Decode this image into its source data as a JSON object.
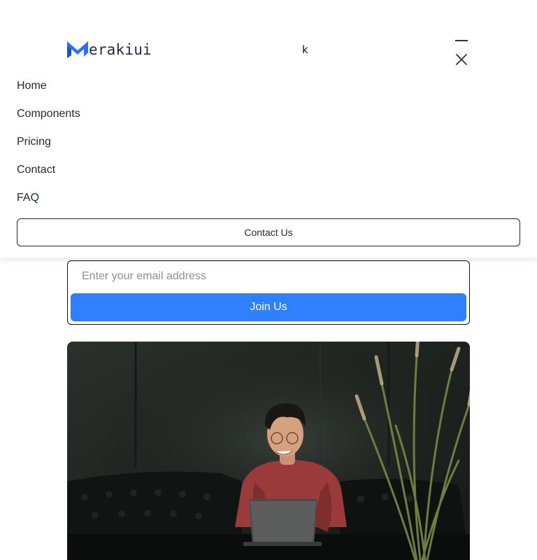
{
  "brand": {
    "logo_text": "erakiui",
    "logo_icon": "m-logo-icon",
    "accent": "#2f80ff"
  },
  "header": {
    "stray_text": "k",
    "menu_icon": "hamburger-icon",
    "close_icon": "close-icon"
  },
  "nav": {
    "items": [
      {
        "label": "Home"
      },
      {
        "label": "Components"
      },
      {
        "label": "Pricing"
      },
      {
        "label": "Contact"
      },
      {
        "label": "FAQ"
      }
    ],
    "contact_button": "Contact Us"
  },
  "signup": {
    "email_placeholder": "Enter your email address",
    "email_value": "",
    "join_label": "Join Us"
  },
  "hero": {
    "image": "person-with-laptop-on-leather-sofa-photo"
  }
}
